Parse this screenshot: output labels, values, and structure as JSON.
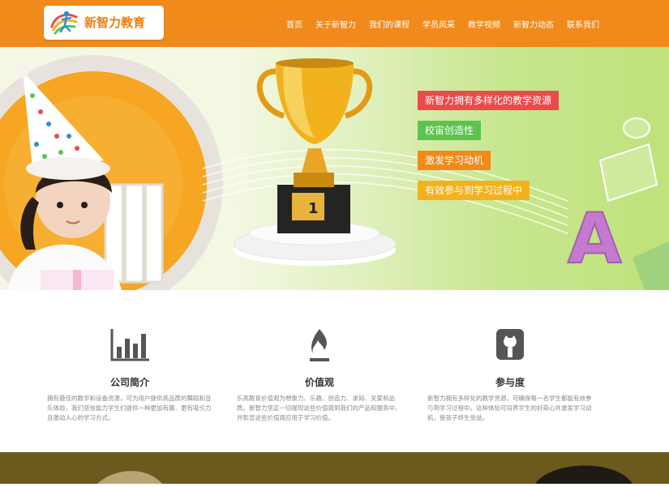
{
  "header": {
    "logo_text": "新智力教育",
    "nav": [
      "首页",
      "关于新智力",
      "我们的课程",
      "学员风采",
      "教学视频",
      "新智力动态",
      "联系我们"
    ]
  },
  "banner": {
    "tags": [
      "新智力拥有多样化的教学资源",
      "校宙创造性",
      "激发学习动机",
      "有效参与到学习过程中"
    ],
    "trophy_number": "1",
    "letter": "A"
  },
  "features": [
    {
      "icon": "bar-chart-icon",
      "title": "公司简介",
      "desc": "拥有最佳的教学和设备资源，可为用户提供高品质的舞蹈和音乐体验，我们坚信能力学生们提供一种更加有趣、更有吸引力且激动人心的学习方式。"
    },
    {
      "icon": "flame-icon",
      "title": "价值观",
      "desc": "乐高教育价值观为想象力、乐趣、创造力、求知、关爱和品质。新智力坚定一切提现这些价值观到我们的产品和服务中，并彰显这些价值观应用于学习价值。"
    },
    {
      "icon": "github-icon",
      "title": "参与度",
      "desc": "新智力拥有多样化的教学资源，可确保每一名学生都能有效参与到学习过程中。这种体验可培养学生的好奇心并激发学习动机，使孩子终生受益。"
    }
  ],
  "colors": {
    "header": "#f08a1a",
    "tag_red": "#e94b4b",
    "tag_green": "#5cc34f",
    "tag_orange": "#f08a1a",
    "tag_yellow": "#f2b21e"
  }
}
